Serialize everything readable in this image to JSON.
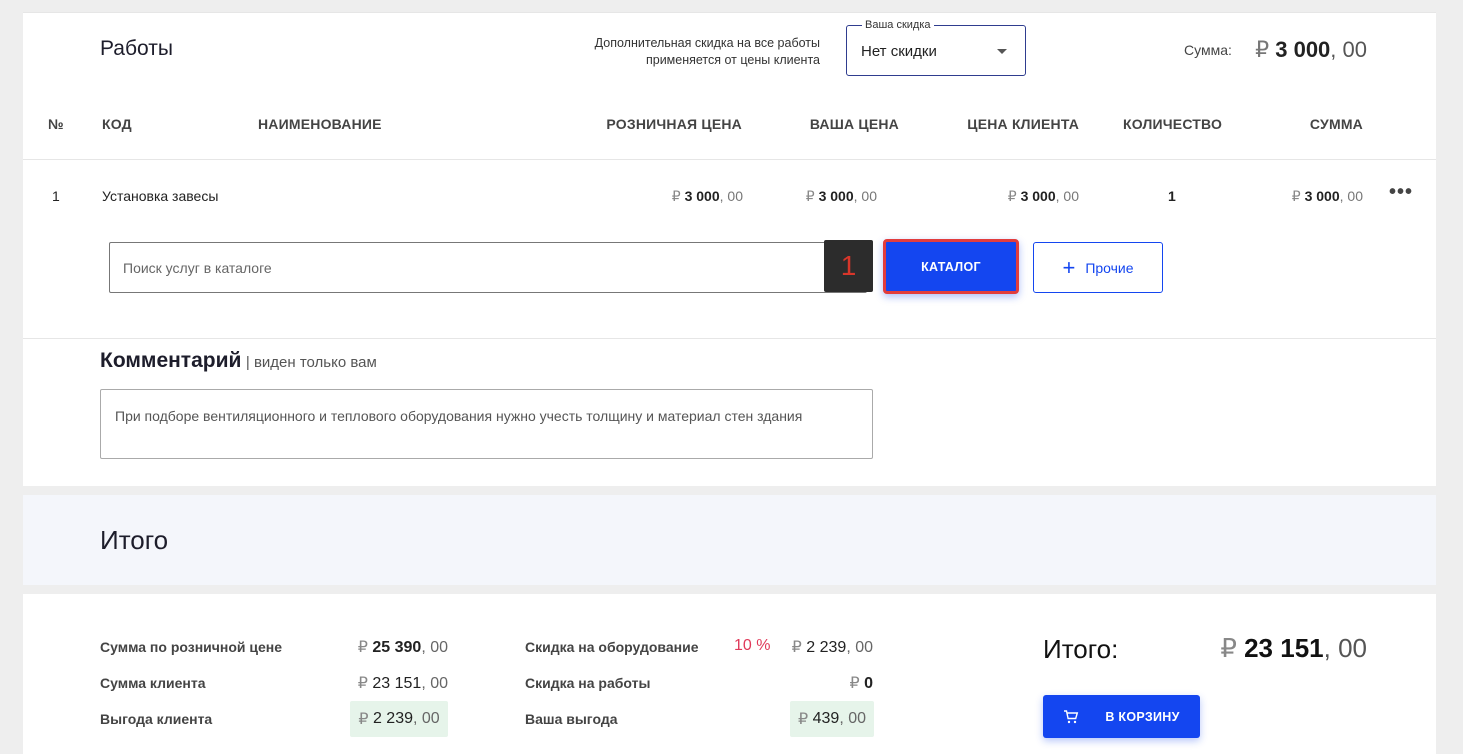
{
  "works": {
    "title": "Работы",
    "discount_hint_line1": "Дополнительная скидка на все работы",
    "discount_hint_line2": "применяется от цены клиента",
    "discount_legend": "Ваша скидка",
    "discount_value": "Нет скидки",
    "sum_label": "Сумма:",
    "sum": {
      "cur": "₽",
      "int": "3 000",
      "frac": ", 00"
    },
    "columns": {
      "num": "№",
      "code": "КОД",
      "name": "НАИМЕНОВАНИЕ",
      "retail": "РОЗНИЧНАЯ ЦЕНА",
      "your_price": "ВАША ЦЕНА",
      "client_price": "ЦЕНА КЛИЕНТА",
      "qty": "КОЛИЧЕСТВО",
      "sum": "СУММА"
    },
    "rows": [
      {
        "num": "1",
        "name": "Установка завесы",
        "retail": {
          "cur": "₽",
          "int": "3 000",
          "frac": ", 00"
        },
        "your_price": {
          "cur": "₽",
          "int": "3 000",
          "frac": ", 00"
        },
        "client_price": {
          "cur": "₽",
          "int": "3 000",
          "frac": ", 00"
        },
        "qty": "1",
        "sum": {
          "cur": "₽",
          "int": "3 000",
          "frac": ", 00"
        },
        "menu": "•••"
      }
    ],
    "search_placeholder": "Поиск услуг в каталоге",
    "badge": "1",
    "catalog_button": "КАТАЛОГ",
    "other_button_plus": "+",
    "other_button": "Прочие"
  },
  "comment": {
    "title": "Комментарий",
    "subtitle": "| виден только вам",
    "text": "При подборе вентиляционного и теплового оборудования нужно учесть толщину и материал стен здания"
  },
  "total": {
    "title": "Итого",
    "retail_sum_label": "Сумма по розничной цене",
    "retail_sum": {
      "cur": "₽",
      "int": "25 390",
      "frac": ", 00"
    },
    "client_sum_label": "Сумма клиента",
    "client_sum": {
      "cur": "₽",
      "int": "23 151",
      "frac": ", 00"
    },
    "client_benefit_label": "Выгода клиента",
    "client_benefit": {
      "cur": "₽",
      "int": "2 239",
      "frac": ", 00"
    },
    "equip_discount_label": "Скидка на оборудование",
    "equip_discount_pct": "10 %",
    "equip_discount": {
      "cur": "₽",
      "int": "2 239",
      "frac": ", 00"
    },
    "works_discount_label": "Скидка на работы",
    "works_discount": {
      "cur": "₽",
      "int": "0"
    },
    "your_benefit_label": "Ваша выгода",
    "your_benefit": {
      "cur": "₽",
      "int": "439",
      "frac": ", 00"
    },
    "grand_label": "Итого:",
    "grand": {
      "cur": "₽",
      "int": "23 151",
      "frac": ", 00"
    },
    "cart_button": "В КОРЗИНУ"
  },
  "colors": {
    "primary": "#1446f0",
    "highlight_border": "#e23d3d",
    "benefit_bg": "#e6f4ea",
    "percent": "#e03a5a"
  }
}
